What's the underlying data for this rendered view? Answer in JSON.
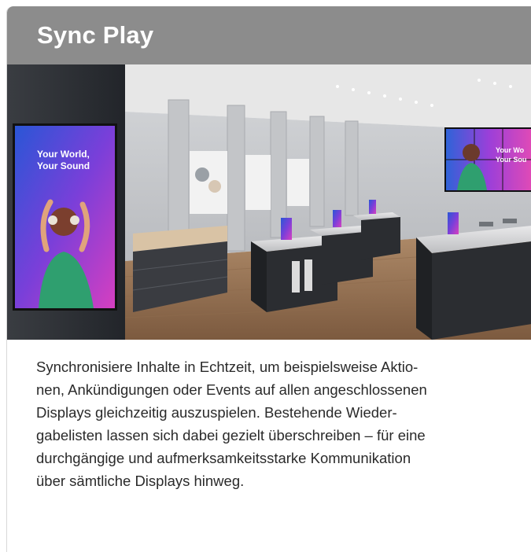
{
  "card": {
    "title": "Sync Play",
    "description_lines": [
      "Synchronisiere Inhalte in Echtzeit, um beispielsweise Aktio-",
      "nen, Ankündigungen oder Events auf allen angeschlossenen",
      "Displays gleichzeitig auszuspielen. Bestehende Wieder-",
      "gabelisten lassen sich dabei gezielt überschreiben – für eine",
      "durchgängige und aufmerksamkeitsstarke Kommunikation",
      "über sämtliche Displays hinweg."
    ]
  },
  "image": {
    "portrait_display_text_line1": "Your World,",
    "portrait_display_text_line2": "Your Sound",
    "videowall_text_line1": "Your Wo",
    "videowall_text_line2": "Your Sou"
  },
  "colors": {
    "header_bg": "#8c8c8c",
    "title_text": "#ffffff",
    "body_text": "#2a2a2a"
  }
}
